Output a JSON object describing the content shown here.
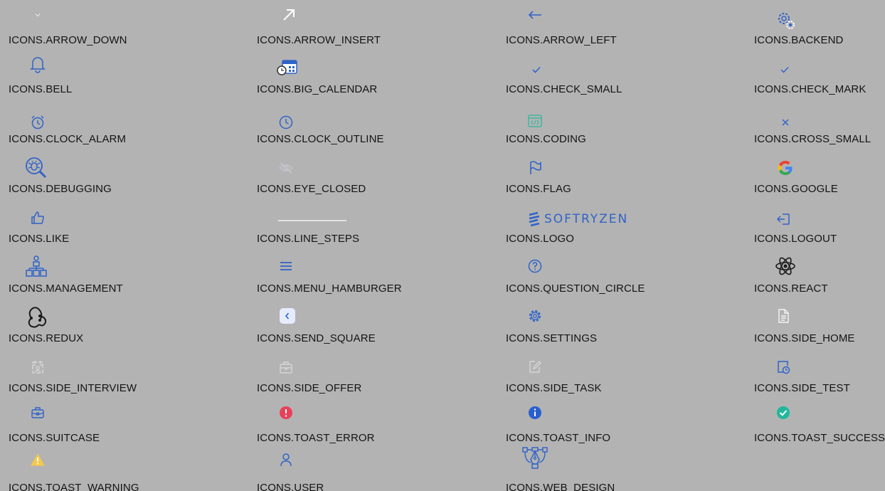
{
  "icons": [
    {
      "label": "ICONS.ARROW_DOWN",
      "icon": "chevron-down-icon"
    },
    {
      "label": "ICONS.ARROW_INSERT",
      "icon": "arrow-insert-icon"
    },
    {
      "label": "ICONS.ARROW_LEFT",
      "icon": "arrow-left-icon"
    },
    {
      "label": "ICONS.BACKEND",
      "icon": "gears-icon"
    },
    {
      "label": "ICONS.BELL",
      "icon": "bell-icon"
    },
    {
      "label": "ICONS.BIG_CALENDAR",
      "icon": "calendar-clock-icon"
    },
    {
      "label": "ICONS.CHECK_SMALL",
      "icon": "check-small-icon"
    },
    {
      "label": "ICONS.CHECK_MARK",
      "icon": "check-mark-icon"
    },
    {
      "label": "ICONS.CLOCK_ALARM",
      "icon": "alarm-clock-icon"
    },
    {
      "label": "ICONS.CLOCK_OUTLINE",
      "icon": "clock-icon"
    },
    {
      "label": "ICONS.CODING",
      "icon": "code-window-icon"
    },
    {
      "label": "ICONS.CROSS_SMALL",
      "icon": "cross-small-icon"
    },
    {
      "label": "ICONS.DEBUGGING",
      "icon": "bug-search-icon"
    },
    {
      "label": "ICONS.EYE_CLOSED",
      "icon": "eye-closed-icon"
    },
    {
      "label": "ICONS.FLAG",
      "icon": "flag-icon"
    },
    {
      "label": "ICONS.GOOGLE",
      "icon": "google-icon"
    },
    {
      "label": "ICONS.LIKE",
      "icon": "thumbs-up-icon"
    },
    {
      "label": "ICONS.LINE_STEPS",
      "icon": "line-steps-icon"
    },
    {
      "label": "ICONS.LOGO",
      "icon": "softryzen-logo",
      "logo_text": "SOFTRYZEN"
    },
    {
      "label": "ICONS.LOGOUT",
      "icon": "logout-icon"
    },
    {
      "label": "ICONS.MANAGEMENT",
      "icon": "org-chart-icon"
    },
    {
      "label": "ICONS.MENU_HAMBURGER",
      "icon": "hamburger-menu-icon"
    },
    {
      "label": "ICONS.QUESTION_CIRCLE",
      "icon": "question-circle-icon"
    },
    {
      "label": "ICONS.REACT",
      "icon": "react-icon"
    },
    {
      "label": "ICONS.REDUX",
      "icon": "redux-icon"
    },
    {
      "label": "ICONS.SEND_SQUARE",
      "icon": "send-square-icon"
    },
    {
      "label": "ICONS.SETTINGS",
      "icon": "gear-icon"
    },
    {
      "label": "ICONS.SIDE_HOME",
      "icon": "document-icon"
    },
    {
      "label": "ICONS.SIDE_INTERVIEW",
      "icon": "calendar-person-icon"
    },
    {
      "label": "ICONS.SIDE_OFFER",
      "icon": "briefcase-icon"
    },
    {
      "label": "ICONS.SIDE_TASK",
      "icon": "edit-square-icon"
    },
    {
      "label": "ICONS.SIDE_TEST",
      "icon": "test-clock-icon"
    },
    {
      "label": "ICONS.SUITCASE",
      "icon": "suitcase-icon"
    },
    {
      "label": "ICONS.TOAST_ERROR",
      "icon": "error-circle-icon"
    },
    {
      "label": "ICONS.TOAST_INFO",
      "icon": "info-circle-icon"
    },
    {
      "label": "ICONS.TOAST_SUCCESS",
      "icon": "success-circle-icon"
    },
    {
      "label": "ICONS.TOAST_WARNING",
      "icon": "warning-triangle-icon"
    },
    {
      "label": "ICONS.USER",
      "icon": "user-icon"
    },
    {
      "label": "ICONS.WEB_DESIGN",
      "icon": "pen-tool-icon"
    }
  ],
  "colors": {
    "background": "#b3b3b3",
    "icon_blue": "#2f63c8",
    "icon_light": "#d8d8d8",
    "label_text": "#141414",
    "error": "#e8405a",
    "success": "#1fb89a",
    "warning": "#f2c94c"
  }
}
